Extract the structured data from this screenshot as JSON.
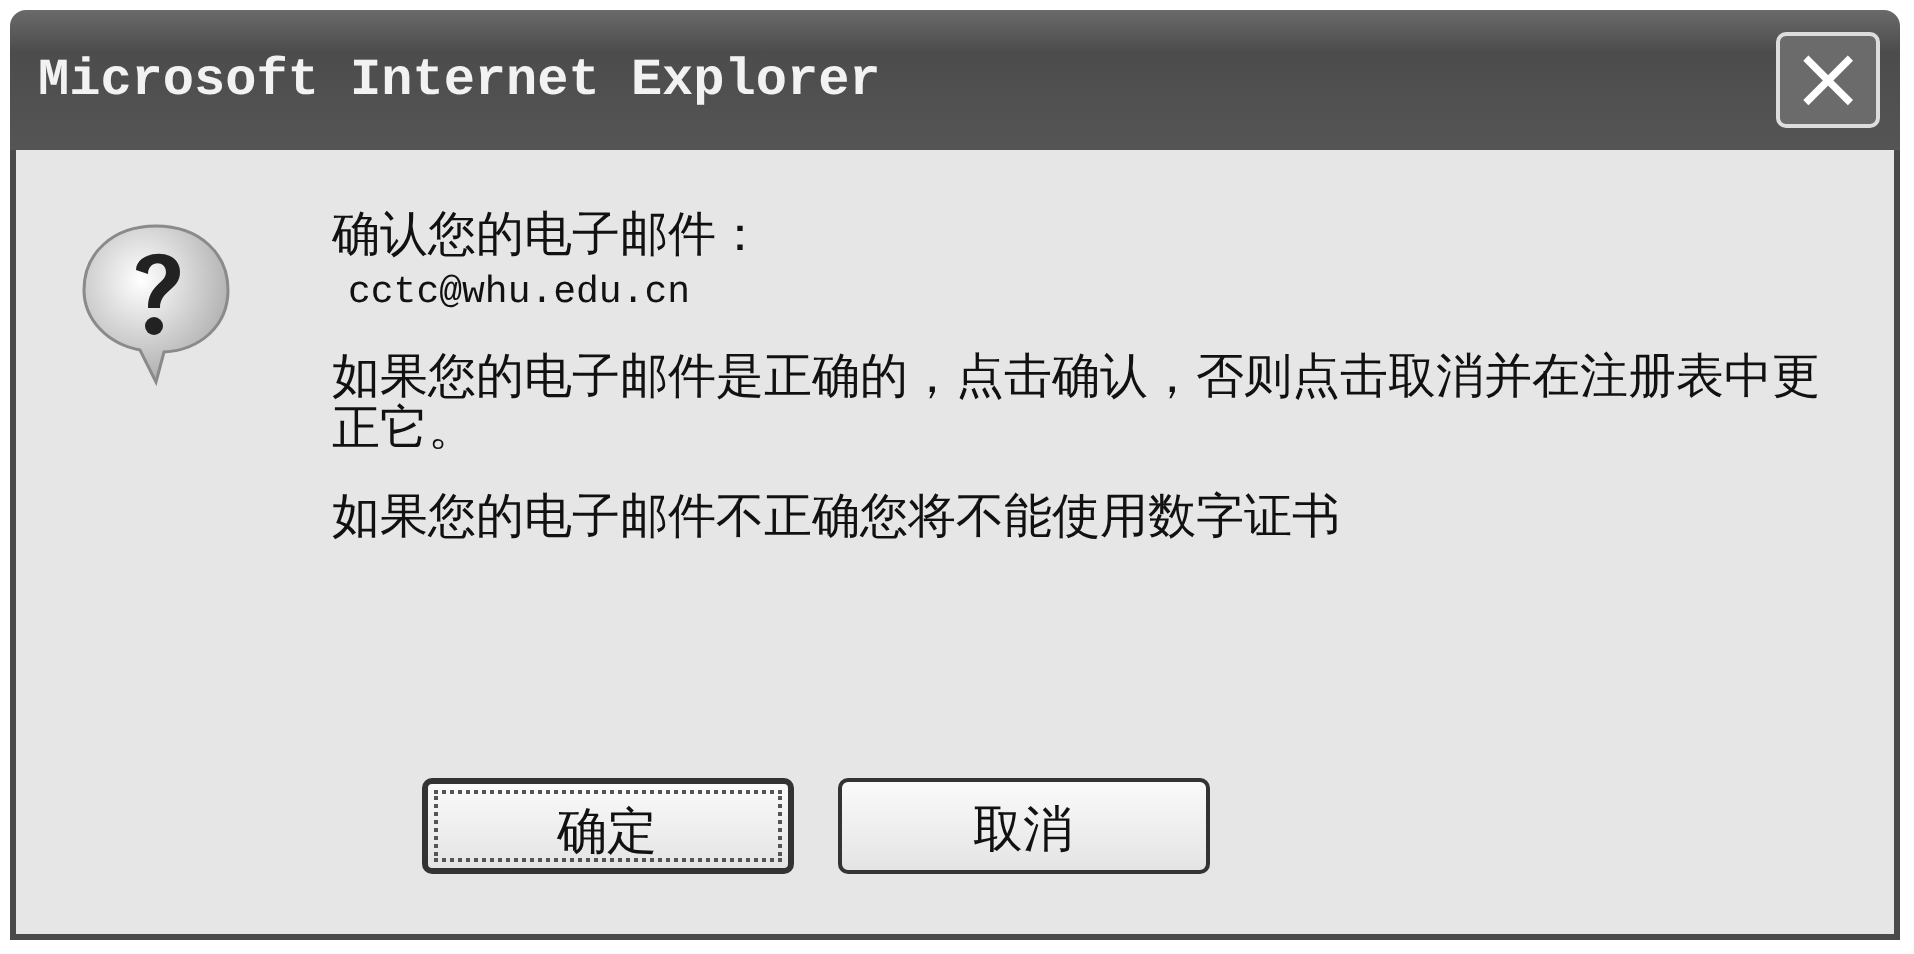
{
  "window": {
    "title": "Microsoft Internet Explorer",
    "close": "×"
  },
  "message": {
    "heading": "确认您的电子邮件：",
    "email": "cctc@whu.edu.cn",
    "paragraphs": [
      "如果您的电子邮件是正确的，点击确认，否则点击取消并在注册表中更正它。",
      "如果您的电子邮件不正确您将不能使用数字证书"
    ]
  },
  "buttons": [
    {
      "label": "确定",
      "focused": true
    },
    {
      "label": "取消",
      "focused": false
    }
  ]
}
